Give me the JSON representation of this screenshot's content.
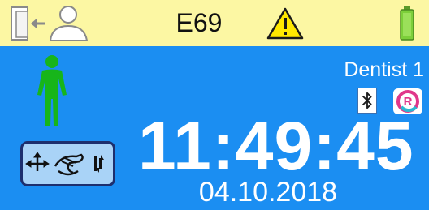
{
  "status_bar": {
    "exit_user_icon": "door-exit-user-icon",
    "error_code": "E69",
    "warning_icon": "warning-triangle-icon",
    "battery_icon": "battery-full-icon",
    "background_color": "#fcf7a3"
  },
  "main": {
    "background_color": "#1b8ef2",
    "patient_icon": "standing-person-icon",
    "patient_icon_color": "#17b51a",
    "user_name": "Dentist 1",
    "bluetooth_icon": "bluetooth-icon",
    "r_badge_label": "R",
    "movement_button_icons": [
      "move-arrows-icon",
      "chair-motor-icon",
      "rotate-icon"
    ],
    "time": "11:49:45",
    "date": "04.10.2018"
  }
}
